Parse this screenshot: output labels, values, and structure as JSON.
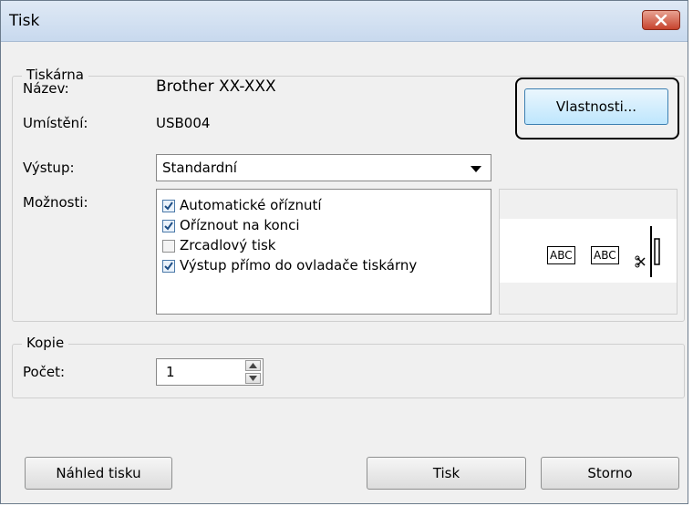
{
  "window": {
    "title": "Tisk"
  },
  "printer": {
    "group_label": "Tiskárna",
    "name_label": "Název:",
    "name_value": "Brother XX-XXX",
    "location_label": "Umístění:",
    "location_value": "USB004",
    "output_label": "Výstup:",
    "output_value": "Standardní",
    "options_label": "Možnosti:",
    "properties_label": "Vlastnosti...",
    "options": [
      {
        "label": "Automatické oříznutí",
        "checked": true
      },
      {
        "label": "Oříznout na konci",
        "checked": true
      },
      {
        "label": "Zrcadlový tisk",
        "checked": false
      },
      {
        "label": "Výstup přímo do ovladače tiskárny",
        "checked": true
      }
    ],
    "preview": {
      "labels": [
        "ABC",
        "ABC"
      ]
    }
  },
  "copies": {
    "group_label": "Kopie",
    "count_label": "Počet:",
    "count_value": "1"
  },
  "buttons": {
    "preview": "Náhled tisku",
    "print": "Tisk",
    "cancel": "Storno"
  },
  "colors": {
    "close_button": "#c7432d",
    "titlebar": "#c8d9ee",
    "highlight_ring": "#000000"
  },
  "icons": [
    "close-icon",
    "chevron-down-icon",
    "checkmark-icon",
    "scissors-icon",
    "arrow-up-icon",
    "arrow-down-icon"
  ]
}
